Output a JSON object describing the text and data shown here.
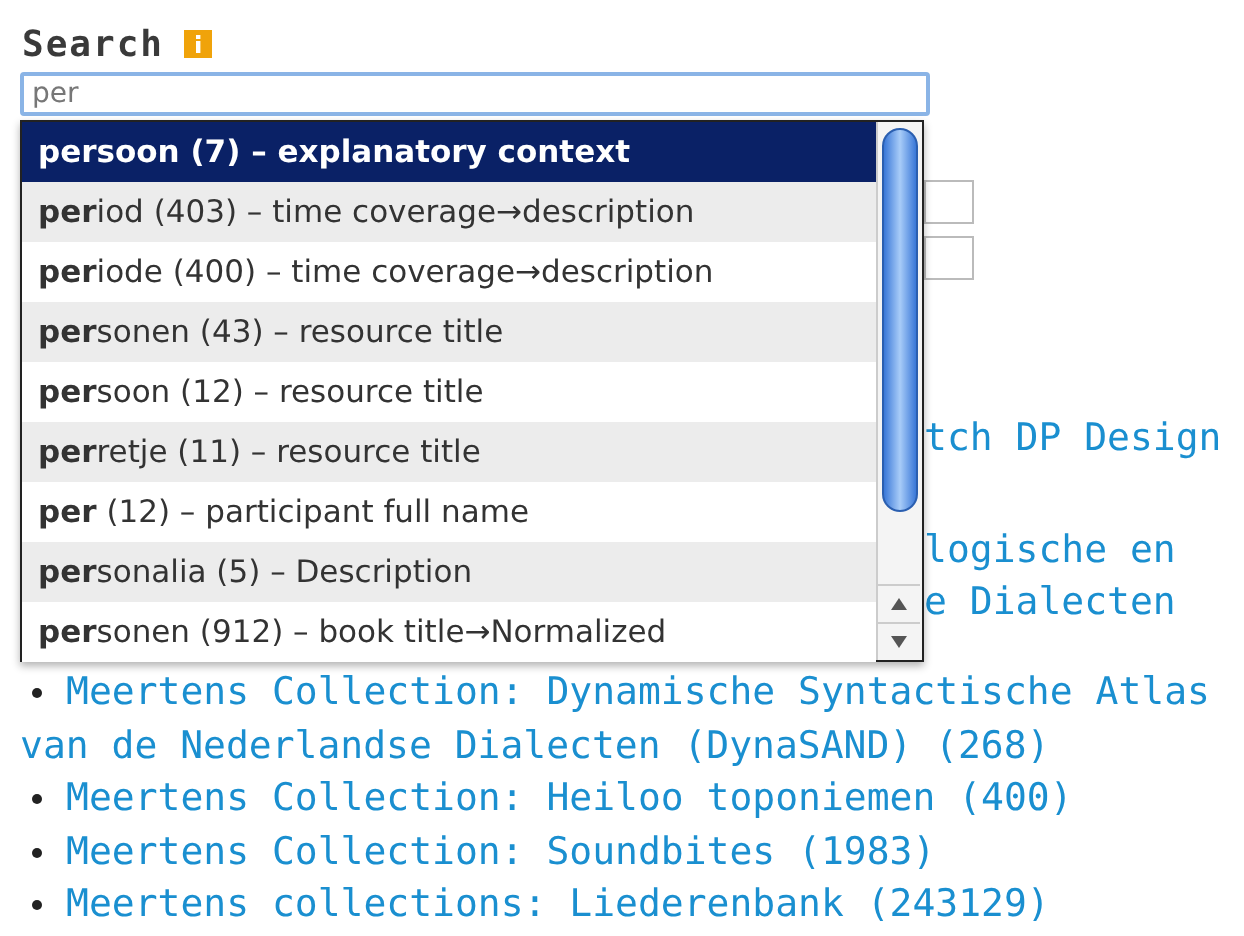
{
  "search": {
    "label": "Search",
    "value": "per"
  },
  "suggestions": [
    {
      "text": "**per**soon (7) – explanatory context",
      "selected": true
    },
    {
      "text": "**per**iod (403) – time coverage→description",
      "selected": false
    },
    {
      "text": "**per**iode (400) – time coverage→description",
      "selected": false
    },
    {
      "text": "**per**sonen (43) – resource title",
      "selected": false
    },
    {
      "text": "**per**soon (12) – resource title",
      "selected": false
    },
    {
      "text": "**per**retje (11) – resource title",
      "selected": false
    },
    {
      "text": "**per** (12) – participant full name",
      "selected": false
    },
    {
      "text": "**per**sonalia (5) – Description",
      "selected": false
    },
    {
      "text": "**per**sonen (912) – book title→Normalized",
      "selected": false
    }
  ],
  "background_fragments": [
    "tch DP Design",
    "logische en",
    "e Dialecten"
  ],
  "results": [
    {
      "text": "Meertens Collection: Dynamische Syntactische Atlas van de Nederlandse Dialecten (DynaSAND) (268)"
    },
    {
      "text": "Meertens Collection: Heiloo toponiemen (400)"
    },
    {
      "text": "Meertens Collection: Soundbites (1983)"
    },
    {
      "text": "Meertens collections: Liederenbank (243129)"
    }
  ]
}
